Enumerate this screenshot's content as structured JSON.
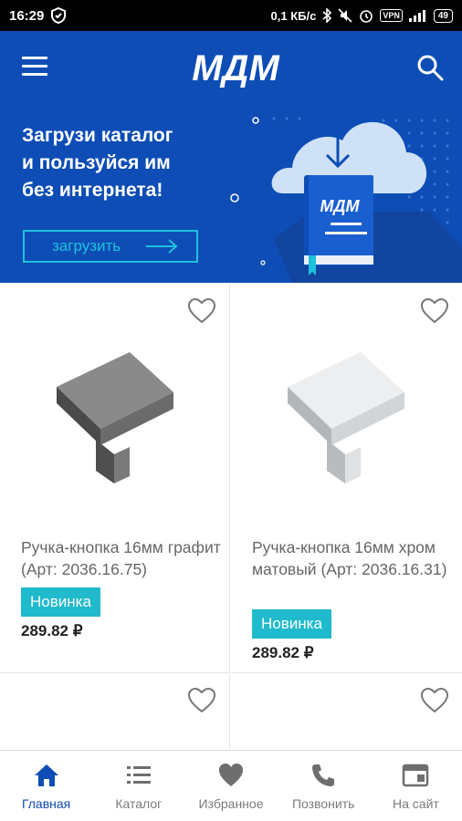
{
  "status_bar": {
    "time": "16:29",
    "network_speed": "0,1 КБ/с",
    "vpn": "VPN",
    "battery": "49"
  },
  "app_bar": {
    "logo_text": "МДМ",
    "menu_icon": "hamburger-menu-icon",
    "search_icon": "search-icon"
  },
  "banner": {
    "headline_1": "Загрузи каталог",
    "headline_2": "и пользуйся им",
    "headline_3": "без интернета!",
    "button_label": "загрузить",
    "book_logo": "МДМ"
  },
  "products": [
    {
      "name": "Ручка-кнопка 16мм графит (Арт: 2036.16.75)",
      "badge": "Новинка",
      "price": "289.82 ₽",
      "color": "#6f6f6f"
    },
    {
      "name": "Ручка-кнопка 16мм хром матовый (Арт: 2036.16.31)",
      "badge": "Новинка",
      "price": "289.82 ₽",
      "color": "#cfd2d4"
    }
  ],
  "bottom_nav": [
    {
      "label": "Главная",
      "icon": "home-icon",
      "active": true
    },
    {
      "label": "Каталог",
      "icon": "list-icon",
      "active": false
    },
    {
      "label": "Избранное",
      "icon": "heart-icon",
      "active": false
    },
    {
      "label": "Позвонить",
      "icon": "phone-icon",
      "active": false
    },
    {
      "label": "На сайт",
      "icon": "browser-icon",
      "active": false
    }
  ],
  "colors": {
    "brand_blue": "#0d4db5",
    "accent_cyan": "#1ec1dc",
    "badge_teal": "#1fbacb"
  }
}
